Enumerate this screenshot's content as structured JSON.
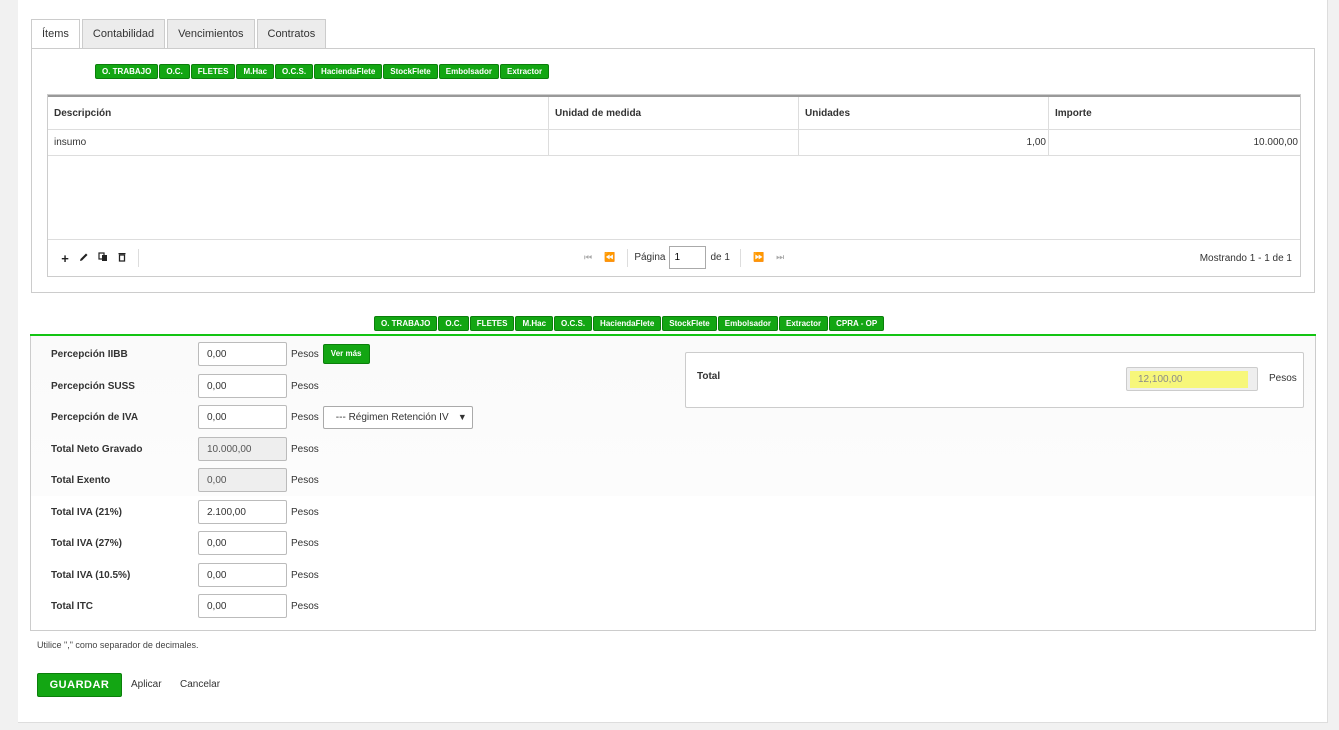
{
  "tabs": [
    "Ítems",
    "Contabilidad",
    "Vencimientos",
    "Contratos"
  ],
  "top_buttons": [
    "O. TRABAJO",
    "O.C.",
    "FLETES",
    "M.Hac",
    "O.C.S.",
    "HaciendaFlete",
    "StockFlete",
    "Embolsador",
    "Extractor"
  ],
  "grid": {
    "headers": [
      "Descripción",
      "Unidad de medida",
      "Unidades",
      "Importe"
    ],
    "rows": [
      {
        "descripcion": "insumo",
        "unidad": "",
        "unidades": "1,00",
        "importe": "10.000,00"
      }
    ],
    "footer": {
      "icons": [
        "add-icon",
        "edit-icon",
        "copy-icon",
        "delete-icon"
      ],
      "page_label": "Página",
      "page_value": "1",
      "of_label": "de 1",
      "showing": "Mostrando 1 - 1 de 1"
    }
  },
  "bottom_buttons": [
    "O. TRABAJO",
    "O.C.",
    "FLETES",
    "M.Hac",
    "O.C.S.",
    "HaciendaFlete",
    "StockFlete",
    "Embolsador",
    "Extractor",
    "CPRA - OP"
  ],
  "fields": {
    "perc_iibb": {
      "label": "Percepción IIBB",
      "value": "0,00",
      "unit": "Pesos",
      "button": "Ver más"
    },
    "perc_suss": {
      "label": "Percepción SUSS",
      "value": "0,00",
      "unit": "Pesos"
    },
    "perc_iva": {
      "label": "Percepción de IVA",
      "value": "0,00",
      "unit": "Pesos",
      "select": "--- Régimen Retención IV"
    },
    "neto_gravado": {
      "label": "Total Neto Gravado",
      "value": "10.000,00",
      "unit": "Pesos"
    },
    "exento": {
      "label": "Total Exento",
      "value": "0,00",
      "unit": "Pesos"
    },
    "iva21": {
      "label": "Total IVA (21%)",
      "value": "2.100,00",
      "unit": "Pesos"
    },
    "iva27": {
      "label": "Total IVA (27%)",
      "value": "0,00",
      "unit": "Pesos"
    },
    "iva105": {
      "label": "Total IVA (10.5%)",
      "value": "0,00",
      "unit": "Pesos"
    },
    "itc": {
      "label": "Total ITC",
      "value": "0,00",
      "unit": "Pesos"
    }
  },
  "total": {
    "label": "Total",
    "value": "12,100,00",
    "unit": "Pesos"
  },
  "hint": "Utilice \",\" como separador de decimales.",
  "actions": {
    "save": "GUARDAR",
    "apply": "Aplicar",
    "cancel": "Cancelar"
  },
  "colors": {
    "accent": "#13a613",
    "highlight": "#f7f77a",
    "line": "#13c413"
  }
}
